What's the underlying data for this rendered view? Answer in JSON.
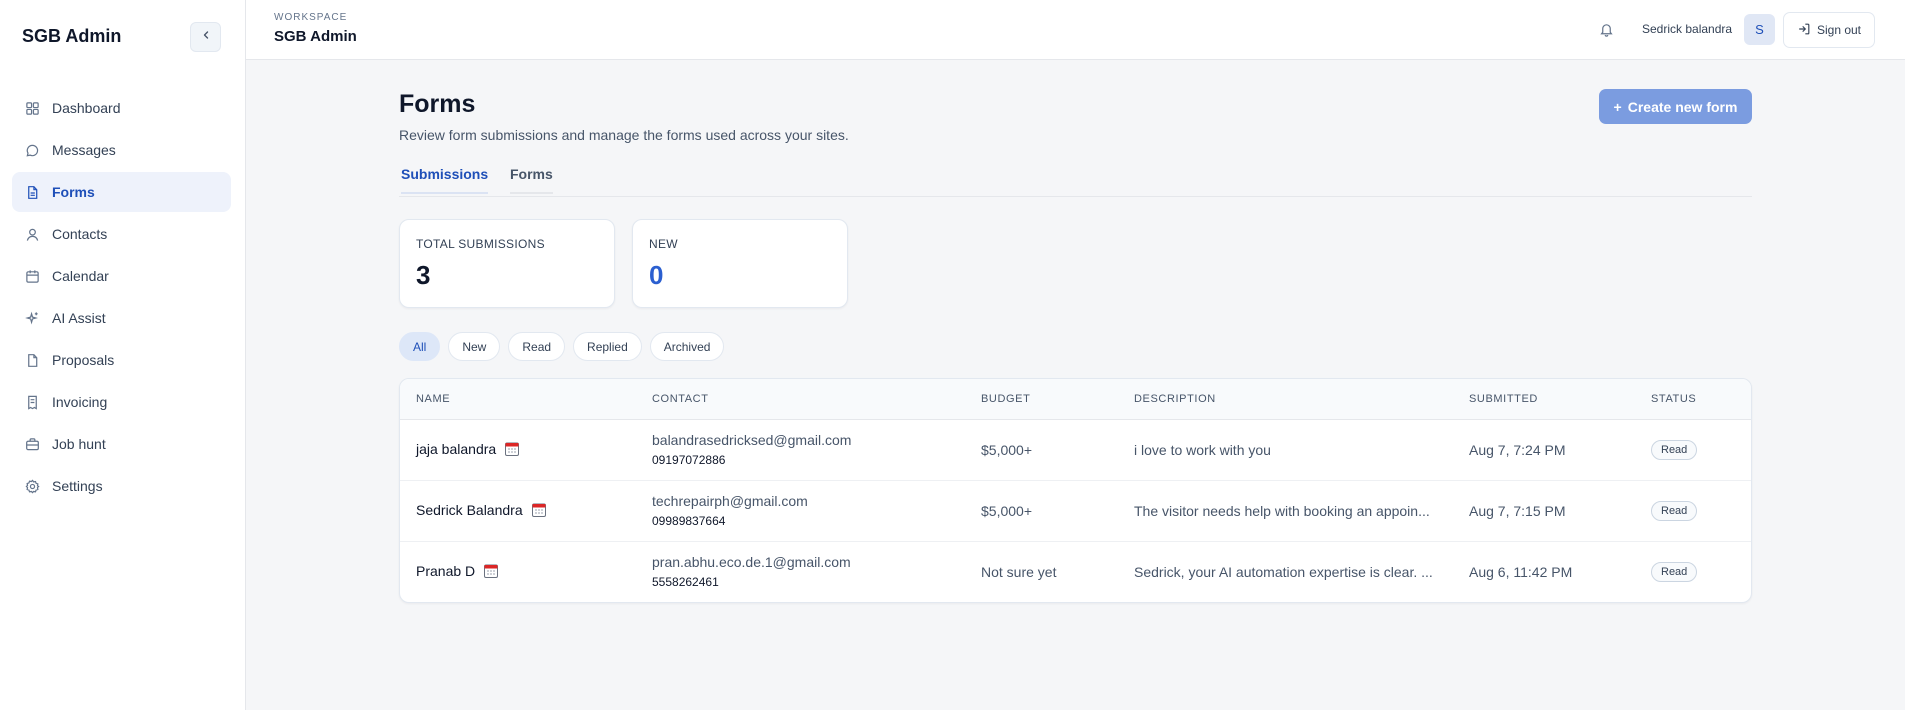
{
  "sidebar": {
    "brand": "SGB Admin",
    "collapse_icon": "chevron-left-icon",
    "items": [
      {
        "label": "Dashboard",
        "icon": "dashboard-icon"
      },
      {
        "label": "Messages",
        "icon": "message-icon"
      },
      {
        "label": "Forms",
        "icon": "document-icon",
        "active": true
      },
      {
        "label": "Contacts",
        "icon": "user-icon"
      },
      {
        "label": "Calendar",
        "icon": "calendar-icon"
      },
      {
        "label": "AI Assist",
        "icon": "sparkle-icon"
      },
      {
        "label": "Proposals",
        "icon": "file-icon"
      },
      {
        "label": "Invoicing",
        "icon": "receipt-icon"
      },
      {
        "label": "Job hunt",
        "icon": "briefcase-icon"
      },
      {
        "label": "Settings",
        "icon": "gear-icon"
      }
    ]
  },
  "topbar": {
    "workspace_label": "WORKSPACE",
    "workspace_name": "SGB Admin",
    "user_name": "Sedrick balandra",
    "avatar_initial": "S",
    "signout_label": "Sign out"
  },
  "main": {
    "title": "Forms",
    "subtitle": "Review form submissions and manage the forms used across your sites.",
    "create_button": "Create new form",
    "tabs": [
      {
        "label": "Submissions",
        "active": true
      },
      {
        "label": "Forms",
        "active": false
      }
    ],
    "stats": [
      {
        "label": "TOTAL SUBMISSIONS",
        "value": "3"
      },
      {
        "label": "NEW",
        "value": "0"
      }
    ],
    "filters": [
      {
        "label": "All",
        "active": true
      },
      {
        "label": "New"
      },
      {
        "label": "Read"
      },
      {
        "label": "Replied"
      },
      {
        "label": "Archived"
      }
    ],
    "table": {
      "headers": [
        "NAME",
        "CONTACT",
        "BUDGET",
        "DESCRIPTION",
        "SUBMITTED",
        "STATUS"
      ],
      "rows": [
        {
          "name": "jaja balandra",
          "email": "balandrasedricksed@gmail.com",
          "phone": "09197072886",
          "budget": "$5,000+",
          "description": "i love to work with you",
          "submitted": "Aug 7, 7:24 PM",
          "status": "Read"
        },
        {
          "name": "Sedrick Balandra",
          "email": "techrepairph@gmail.com",
          "phone": "09989837664",
          "budget": "$5,000+",
          "description": "The visitor needs help with booking an appoin...",
          "submitted": "Aug 7, 7:15 PM",
          "status": "Read"
        },
        {
          "name": "Pranab D",
          "email": "pran.abhu.eco.de.1@gmail.com",
          "phone": "5558262461",
          "budget": "Not sure yet",
          "description": "Sedrick, your AI automation expertise is clear. ...",
          "submitted": "Aug 6, 11:42 PM",
          "status": "Read"
        }
      ]
    }
  },
  "colors": {
    "accent": "#1e4fb8",
    "create_button_bg": "#7b9ce0",
    "active_nav_bg": "#eef2fb",
    "page_bg": "#f5f6f8"
  }
}
